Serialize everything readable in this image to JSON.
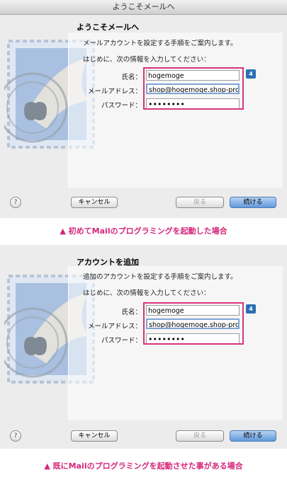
{
  "window_title": "ようこそメールへ",
  "panel1": {
    "heading": "ようこそメールへ",
    "intro": "メールアカウントを設定する手順をご案内します。",
    "instruction": "はじめに、次の情報を入力してください：",
    "labels": {
      "name": "氏名：",
      "email": "メールアドレス：",
      "password": "パスワード："
    },
    "values": {
      "name": "hogemoge",
      "email": "shop@hogemoge.shop-pro.jp",
      "password": "••••••••"
    },
    "badge": "4",
    "buttons": {
      "help": "?",
      "cancel": "キャンセル",
      "back": "戻る",
      "continue": "続ける"
    },
    "caption": "▲ 初めてMailのプログラミングを起動した場合"
  },
  "panel2": {
    "heading": "アカウントを追加",
    "intro": "追加のアカウントを設定する手順をご案内します。",
    "instruction": "はじめに、次の情報を入力してください：",
    "labels": {
      "name": "氏名：",
      "email": "メールアドレス：",
      "password": "パスワード："
    },
    "values": {
      "name": "hogemoge",
      "email": "shop@hogemoge.shop-pro.jp",
      "password": "••••••••"
    },
    "badge": "4",
    "buttons": {
      "help": "?",
      "cancel": "キャンセル",
      "back": "戻る",
      "continue": "続ける"
    },
    "caption": "▲ 既にMailのプログラミングを起動させた事がある場合"
  },
  "colors": {
    "highlight": "#d8357d",
    "badge": "#2b6fb3",
    "caption": "#d4277b",
    "default_button": "#5f99dc"
  }
}
